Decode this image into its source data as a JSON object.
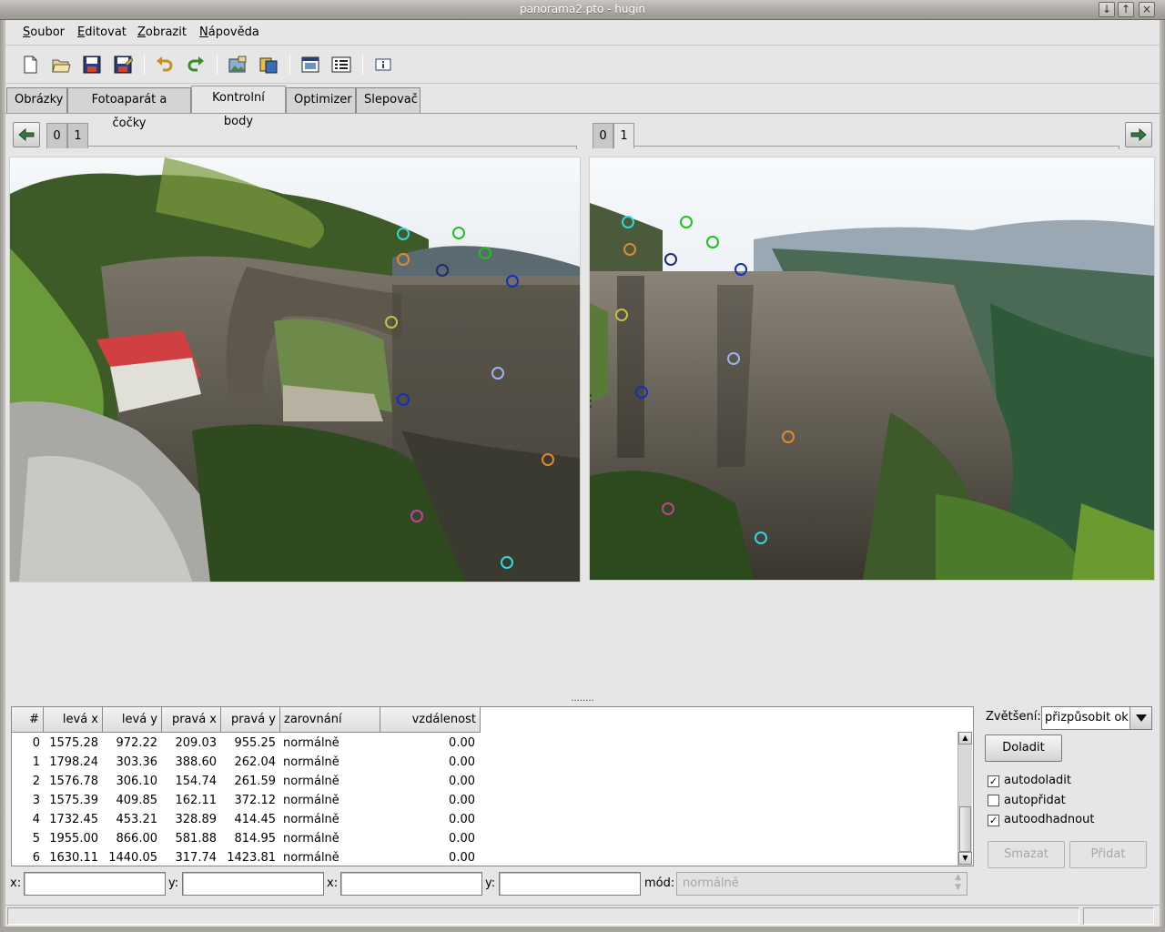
{
  "window": {
    "title": "panorama2.pto - hugin",
    "controls": [
      "↓",
      "↑",
      "×"
    ]
  },
  "menu": [
    "Soubor",
    "Editovat",
    "Zobrazit",
    "Nápověda"
  ],
  "toolbar": {
    "icons": [
      "new-file-icon",
      "open-folder-icon",
      "save-icon",
      "save-as-icon",
      "undo-icon",
      "redo-icon",
      "add-images-icon",
      "add-image-series-icon",
      "preview-window-icon",
      "options-list-icon",
      "about-info-icon"
    ]
  },
  "tabs": [
    "Obrázky",
    "Fotoaparát a čočky",
    "Kontrolní body",
    "Optimizer",
    "Slepovač"
  ],
  "active_tab": "Kontrolní body",
  "left_image_tabs": [
    "0",
    "1"
  ],
  "right_image_tabs": [
    "0",
    "1"
  ],
  "table": {
    "headers": [
      "#",
      "levá x",
      "levá y",
      "pravá x",
      "pravá y",
      "zarovnání",
      "vzdálenost"
    ],
    "rows": [
      [
        "0",
        "1575.28",
        "972.22",
        "209.03",
        "955.25",
        "normálně",
        "0.00"
      ],
      [
        "1",
        "1798.24",
        "303.36",
        "388.60",
        "262.04",
        "normálně",
        "0.00"
      ],
      [
        "2",
        "1576.78",
        "306.10",
        "154.74",
        "261.59",
        "normálně",
        "0.00"
      ],
      [
        "3",
        "1575.39",
        "409.85",
        "162.11",
        "372.12",
        "normálně",
        "0.00"
      ],
      [
        "4",
        "1732.45",
        "453.21",
        "328.89",
        "414.45",
        "normálně",
        "0.00"
      ],
      [
        "5",
        "1955.00",
        "866.00",
        "581.88",
        "814.95",
        "normálně",
        "0.00"
      ],
      [
        "6",
        "1630.11",
        "1440.05",
        "317.74",
        "1423.81",
        "normálně",
        "0.00"
      ]
    ]
  },
  "inputs": {
    "x_label": "x:",
    "y_label": "y:",
    "x2_label": "x:",
    "y2_label": "y:",
    "mode_label": "mód:",
    "mode_value": "normálně"
  },
  "controls": {
    "zoom_label": "Zvětšení:",
    "zoom_value": "přizpůsobit okno",
    "fine_tune": "Doladit",
    "auto_fine_tune": {
      "label": "autodoladit",
      "checked": true
    },
    "auto_add": {
      "label": "autopřidat",
      "checked": false
    },
    "auto_estimate": {
      "label": "autoodhadnout",
      "checked": true
    },
    "delete": "Smazat",
    "add": "Přidat"
  },
  "splitter_h": "........",
  "splitter_v": "⋮",
  "colors": {
    "cp_cyan": "#30d8e0",
    "cp_green": "#20c020",
    "cp_orange": "#e08a30",
    "cp_navy": "#202a70",
    "cp_blue": "#1030c0",
    "cp_olive": "#c8c040",
    "cp_lightblue": "#9ab4f0",
    "cp_magenta": "#c040a0"
  }
}
